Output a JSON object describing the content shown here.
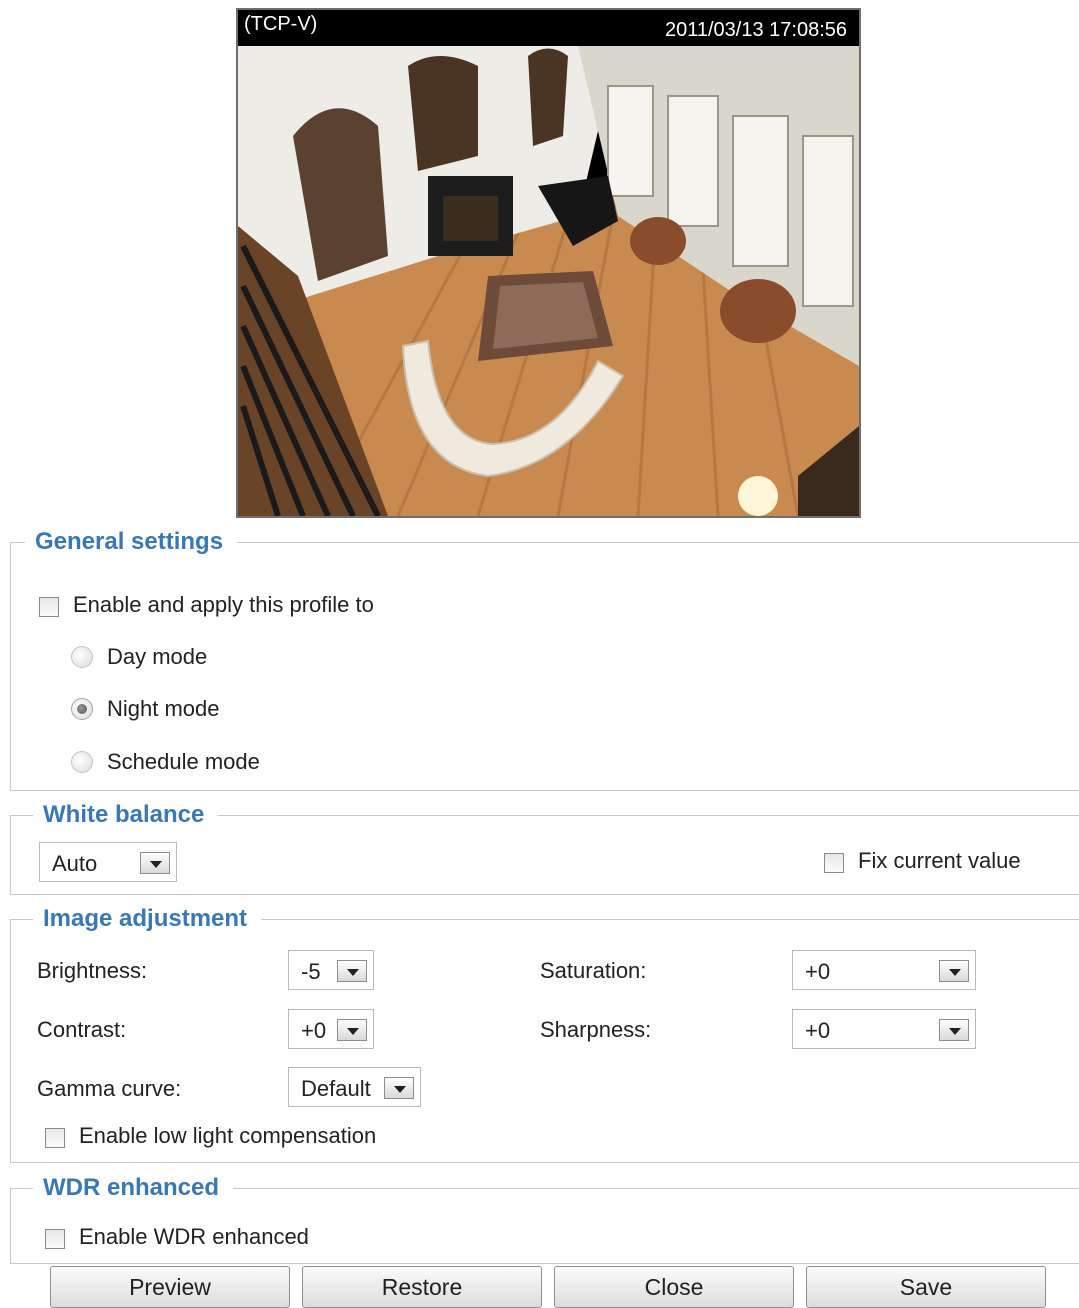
{
  "video": {
    "protocol": "(TCP-V)",
    "timestamp": "2011/03/13  17:08:56"
  },
  "general": {
    "legend": "General settings",
    "enable_label": "Enable and apply this profile to",
    "enable_checked": false,
    "modes": [
      {
        "label": "Day mode",
        "selected": false
      },
      {
        "label": "Night mode",
        "selected": true
      },
      {
        "label": "Schedule mode",
        "selected": false
      }
    ]
  },
  "white_balance": {
    "legend": "White balance",
    "mode": "Auto",
    "fix_label": "Fix current value",
    "fix_checked": false
  },
  "image_adjustment": {
    "legend": "Image adjustment",
    "brightness_label": "Brightness:",
    "brightness": "-5",
    "contrast_label": "Contrast:",
    "contrast": "+0",
    "gamma_label": "Gamma curve:",
    "gamma": "Default",
    "saturation_label": "Saturation:",
    "saturation": "+0",
    "sharpness_label": "Sharpness:",
    "sharpness": "+0",
    "low_light_label": "Enable low light compensation",
    "low_light_checked": false
  },
  "wdr": {
    "legend": "WDR enhanced",
    "enable_label": "Enable WDR enhanced",
    "enable_checked": false
  },
  "buttons": {
    "preview": "Preview",
    "restore": "Restore",
    "close": "Close",
    "save": "Save"
  }
}
